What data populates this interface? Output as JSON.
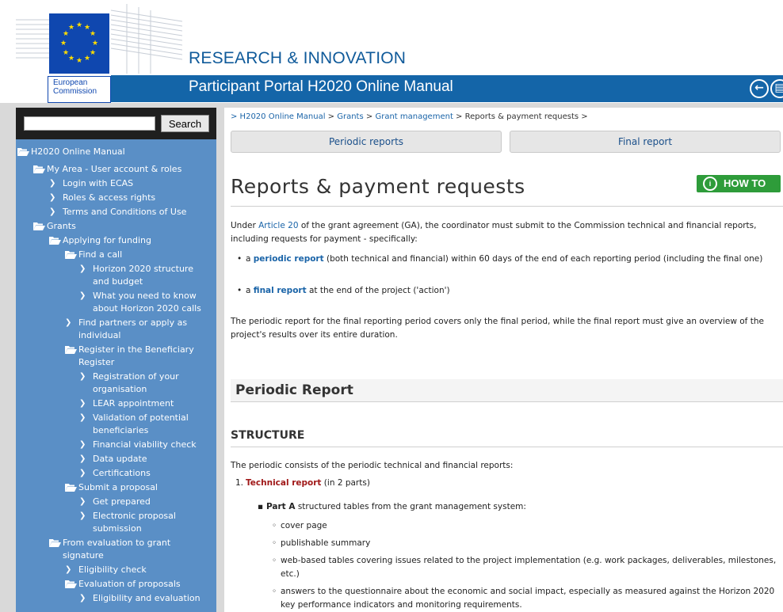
{
  "header": {
    "logo_line1": "European",
    "logo_line2": "Commission",
    "site_title": "RESEARCH & INNOVATION",
    "portal_title": "Participant Portal H2020 Online Manual"
  },
  "sidebar": {
    "search_placeholder": "",
    "search_button": "Search",
    "nav": [
      {
        "label": "H2020 Online Manual",
        "level": 0,
        "icon": "folder-open-icon"
      },
      {
        "label": "My Area - User account & roles",
        "level": 1,
        "icon": "folder-open-icon"
      },
      {
        "label": "Login with ECAS",
        "level": 2,
        "icon": "chevron-right-icon"
      },
      {
        "label": "Roles & access rights",
        "level": 2,
        "icon": "chevron-right-icon"
      },
      {
        "label": "Terms and Conditions of Use",
        "level": 2,
        "icon": "chevron-right-icon"
      },
      {
        "label": "Grants",
        "level": 1,
        "icon": "folder-open-icon"
      },
      {
        "label": "Applying for funding",
        "level": 2,
        "icon": "folder-open-icon"
      },
      {
        "label": "Find a call",
        "level": 3,
        "icon": "folder-open-icon"
      },
      {
        "label": "Horizon 2020 structure and budget",
        "level": 4,
        "icon": "chevron-right-icon"
      },
      {
        "label": "What you need to know about Horizon 2020 calls",
        "level": 4,
        "icon": "chevron-right-icon"
      },
      {
        "label": "Find partners or apply as individual",
        "level": 3,
        "icon": "chevron-right-icon"
      },
      {
        "label": "Register in the Beneficiary Register",
        "level": 3,
        "icon": "folder-open-icon"
      },
      {
        "label": "Registration of your organisation",
        "level": 4,
        "icon": "chevron-right-icon"
      },
      {
        "label": "LEAR appointment",
        "level": 4,
        "icon": "chevron-right-icon"
      },
      {
        "label": "Validation of potential beneficiaries",
        "level": 4,
        "icon": "chevron-right-icon"
      },
      {
        "label": "Financial viability check",
        "level": 4,
        "icon": "chevron-right-icon"
      },
      {
        "label": "Data update",
        "level": 4,
        "icon": "chevron-right-icon"
      },
      {
        "label": "Certifications",
        "level": 4,
        "icon": "chevron-right-icon"
      },
      {
        "label": "Submit a proposal",
        "level": 3,
        "icon": "folder-open-icon"
      },
      {
        "label": "Get prepared",
        "level": 4,
        "icon": "chevron-right-icon"
      },
      {
        "label": "Electronic proposal submission",
        "level": 4,
        "icon": "chevron-right-icon"
      },
      {
        "label": "From evaluation to grant signature",
        "level": 2,
        "icon": "folder-open-icon"
      },
      {
        "label": "Eligibility check",
        "level": 3,
        "icon": "chevron-right-icon"
      },
      {
        "label": "Evaluation of proposals",
        "level": 3,
        "icon": "folder-open-icon"
      },
      {
        "label": "Eligibility and evaluation",
        "level": 4,
        "icon": "chevron-right-icon"
      }
    ]
  },
  "content": {
    "breadcrumb": [
      {
        "label": "> H2020 Online Manual",
        "link": true
      },
      {
        "label": " > ",
        "link": false
      },
      {
        "label": "Grants",
        "link": true
      },
      {
        "label": " > ",
        "link": false
      },
      {
        "label": "Grant management",
        "link": true
      },
      {
        "label": " > Reports & payment requests >",
        "link": false
      }
    ],
    "tabs": [
      "Periodic reports",
      "Final report"
    ],
    "title": "Reports & payment requests",
    "howto": "HOW TO",
    "howto_icon": "i",
    "intro": {
      "pre": "Under ",
      "link": "Article 20",
      "post": " of the grant agreement (GA), the coordinator must submit to the Commission technical and financial reports, including requests for payment - specifically:"
    },
    "bullets": [
      {
        "pre": "a ",
        "link": "periodic report",
        "post": " (both technical and financial) within 60 days of the end of each reporting period (including the final one)"
      },
      {
        "pre": "a ",
        "link": "final report",
        "post": " at the end of the project ('action')"
      }
    ],
    "para2": "The periodic report for the final reporting period covers only the final period, while the final report must give an overview of the project's results over its entire duration.",
    "section": "Periodic Report",
    "subsection": "STRUCTURE",
    "para3": "The periodic consists of the periodic technical and financial reports:",
    "list1": {
      "num": "1.",
      "link": "Technical report",
      "post": " (in 2 parts)"
    },
    "partA": {
      "bold": "Part A",
      "post": " structured tables from the grant management system:"
    },
    "subitems": [
      "cover page",
      "publishable summary",
      "web-based tables covering issues related to the project implementation (e.g. work packages, deliverables, milestones, etc.)",
      "answers to the questionnaire about the economic and social impact, especially as measured against the Horizon 2020 key performance indicators and monitoring requirements."
    ]
  }
}
